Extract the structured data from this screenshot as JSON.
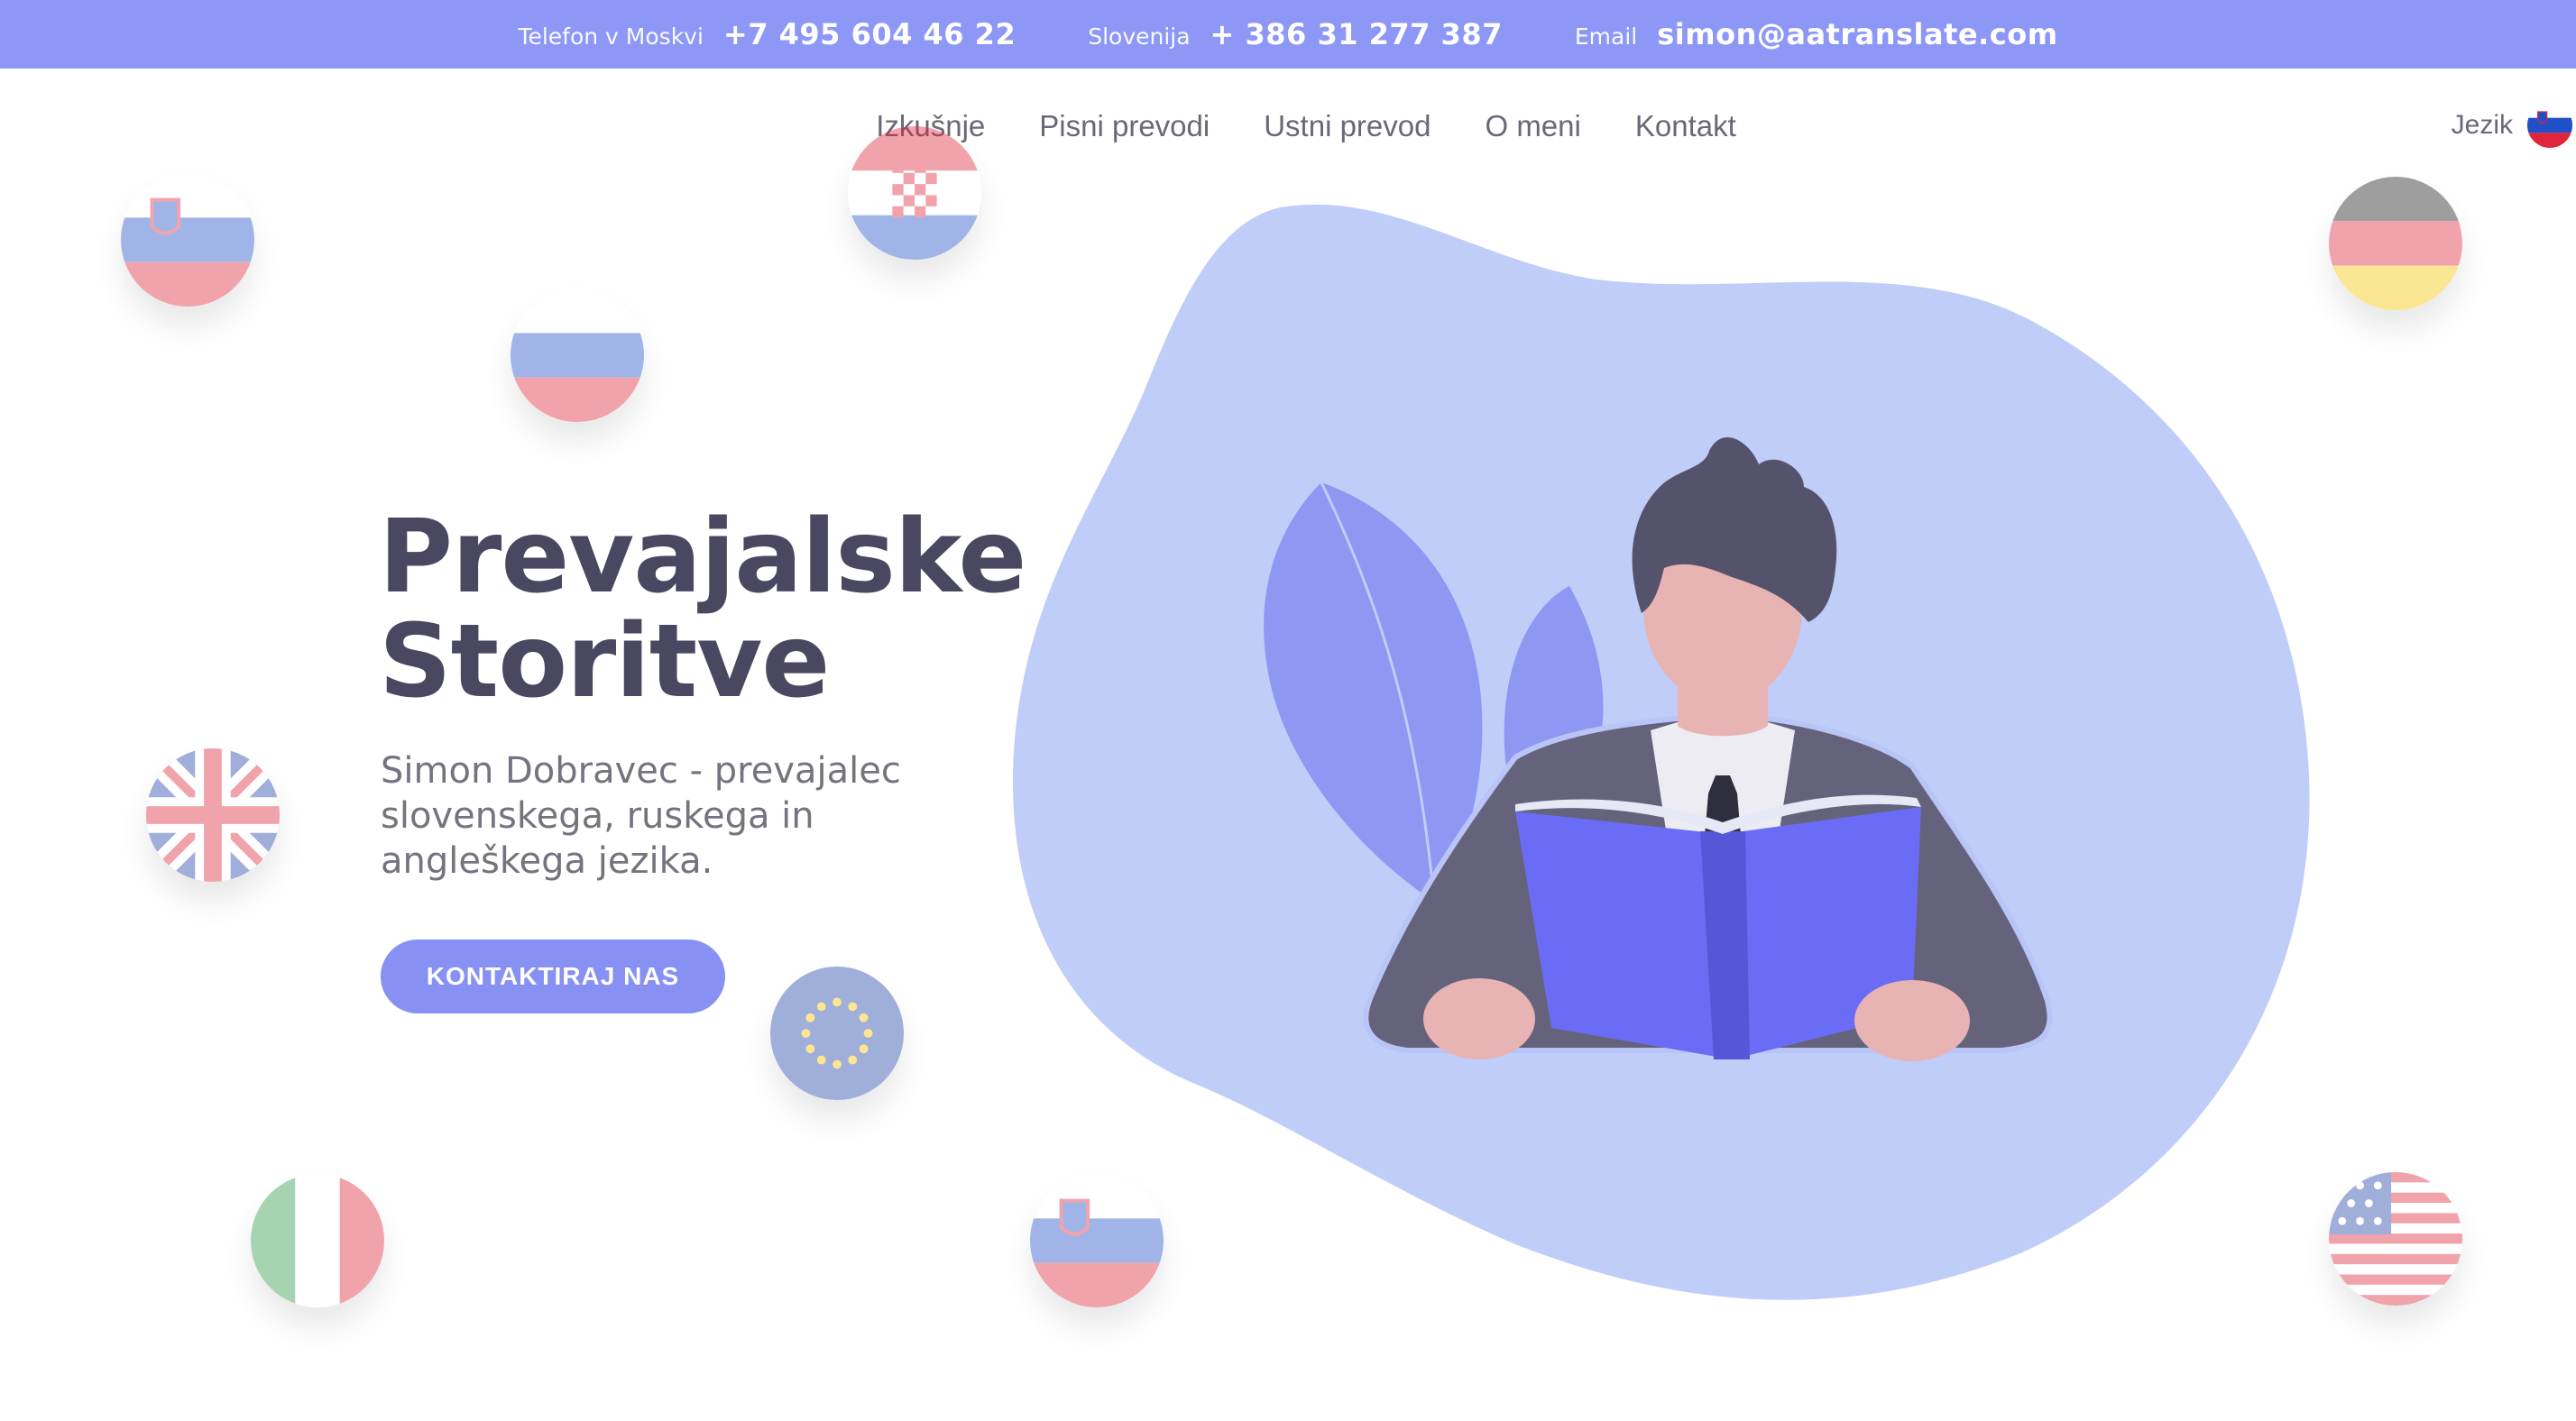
{
  "topbar": {
    "moscow_label": "Telefon v Moskvi",
    "moscow_phone": "+7 495 604 46 22",
    "slovenia_label": "Slovenija",
    "slovenia_phone": "+ 386 31 277 387",
    "email_label": "Email",
    "email": "simon@aatranslate.com"
  },
  "nav": {
    "items": [
      "Izkušnje",
      "Pisni prevodi",
      "Ustni prevod",
      "O meni",
      "Kontakt"
    ]
  },
  "language": {
    "label": "Jezik",
    "current_flag": "slovenia-flag-icon"
  },
  "hero": {
    "title_line1": "Prevajalske",
    "title_line2": "Storitve",
    "subtitle": "Simon Dobravec - prevajalec slovenskega, ruskega in angleškega jezika.",
    "cta": "KONTAKTIRAJ NAS"
  },
  "decor_flags": [
    "slovenia-flag-icon",
    "croatia-flag-icon",
    "russia-flag-icon",
    "germany-flag-icon",
    "uk-flag-icon",
    "eu-flag-icon",
    "italy-flag-icon",
    "slovenia-flag-icon",
    "usa-flag-icon"
  ],
  "colors": {
    "accent": "#8d97f5",
    "button": "#8791f3",
    "blob": "#c0cdf9",
    "heading": "#4a4861",
    "book": "#6b6cf5"
  }
}
